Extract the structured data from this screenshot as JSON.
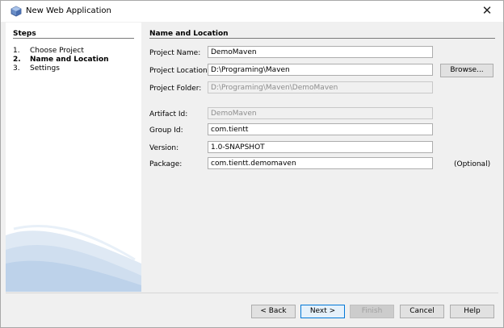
{
  "window": {
    "title": "New Web Application",
    "app_icon": "netbeans-cube-icon",
    "close_glyph": "✕"
  },
  "steps": {
    "title": "Steps",
    "items": [
      {
        "num": "1.",
        "label": "Choose Project",
        "active": false
      },
      {
        "num": "2.",
        "label": "Name and Location",
        "active": true
      },
      {
        "num": "3.",
        "label": "Settings",
        "active": false
      }
    ]
  },
  "form": {
    "section_title": "Name and Location",
    "project_name": {
      "label": "Project Name:",
      "value": "DemoMaven"
    },
    "project_location": {
      "label": "Project Location:",
      "value": "D:\\Programing\\Maven",
      "browse_label": "Browse..."
    },
    "project_folder": {
      "label": "Project Folder:",
      "value": "D:\\Programing\\Maven\\DemoMaven"
    },
    "artifact_id": {
      "label": "Artifact Id:",
      "value": "DemoMaven"
    },
    "group_id": {
      "label": "Group Id:",
      "value": "com.tientt"
    },
    "version": {
      "label": "Version:",
      "value": "1.0-SNAPSHOT"
    },
    "package": {
      "label": "Package:",
      "value": "com.tientt.demomaven",
      "optional": "(Optional)"
    }
  },
  "buttons": {
    "back": "< Back",
    "next": "Next >",
    "finish": "Finish",
    "cancel": "Cancel",
    "help": "Help"
  },
  "colors": {
    "focus_accent": "#0078d7",
    "panel_bg": "#f0f0f0",
    "steps_bg": "#ffffff"
  }
}
